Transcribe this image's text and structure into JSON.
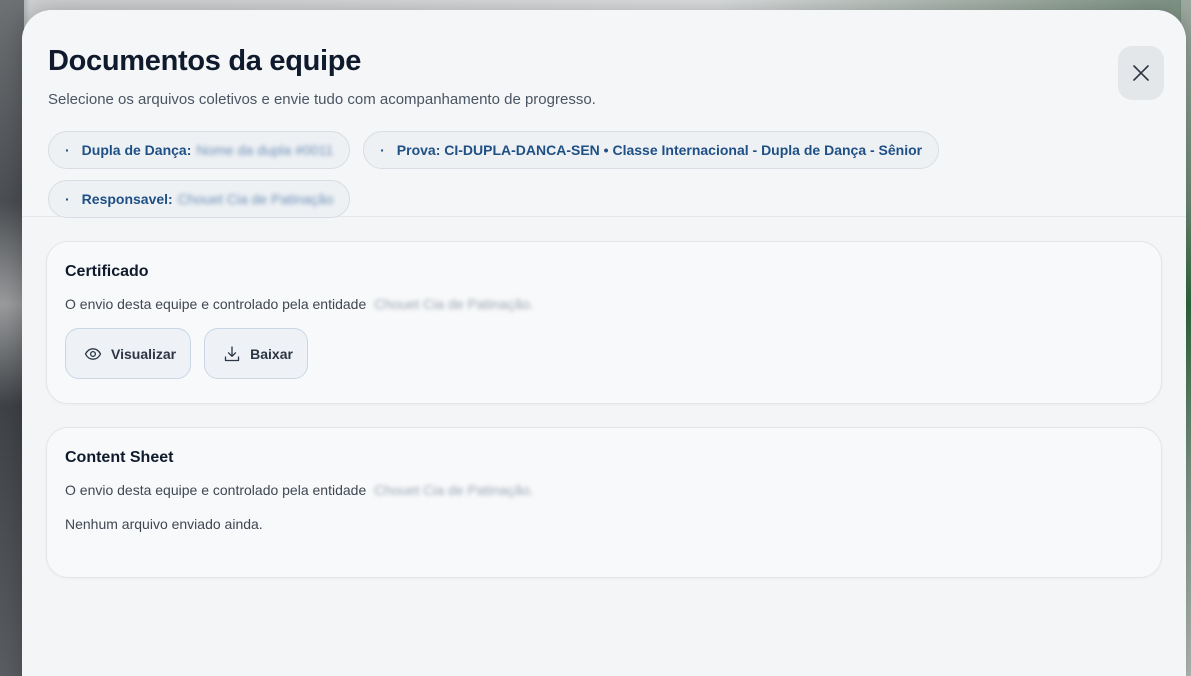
{
  "modal": {
    "title": "Documentos da equipe",
    "subtitle": "Selecione os arquivos coletivos e envie tudo com acompanhamento de progresso."
  },
  "chips": [
    {
      "label": "Dupla de Dança:",
      "value": "Nome da dupla #0011"
    },
    {
      "label": "Prova: CI-DUPLA-DANCA-SEN • Classe Internacional - Dupla de Dança - Sênior",
      "value": ""
    },
    {
      "label": "Responsavel:",
      "value": "Chouet Cia de Patinação"
    }
  ],
  "icons": {
    "close": "close-icon",
    "view": "eye-icon",
    "download": "download-icon"
  },
  "cards": [
    {
      "title": "Certificado",
      "text": "O envio desta equipe e controlado pela entidade",
      "entity": "Chouet Cia de Patinação.",
      "buttons": {
        "view": "Visualizar",
        "download": "Baixar"
      }
    },
    {
      "title": "Content Sheet",
      "text": "O envio desta equipe e controlado pela entidade",
      "entity": "Chouet Cia de Patinação.",
      "status": "Nenhum arquivo enviado ainda."
    }
  ]
}
